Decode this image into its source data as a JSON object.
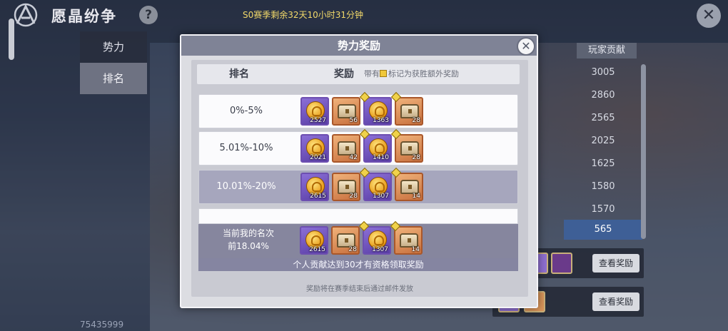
{
  "header": {
    "title": "愿晶纷争",
    "help_label": "?",
    "season_text": "S0赛季剩余32天10小时31分钟",
    "close_label": "✕"
  },
  "side_tabs": [
    {
      "label": "势力"
    },
    {
      "label": "排名"
    }
  ],
  "background_list": {
    "column_header": "玩家贡献",
    "values": [
      "3005",
      "2860",
      "2565",
      "2025",
      "1625",
      "1580",
      "1570",
      "565"
    ],
    "view_reward_label": "查看奖励",
    "player_id": "75435999"
  },
  "modal": {
    "title": "势力奖励",
    "close_label": "✕",
    "col_rank": "排名",
    "col_reward": "奖励",
    "note_prefix": "带有",
    "note_suffix": "标记为获胜额外奖励",
    "tiers": [
      {
        "label": "0%-5%",
        "items": [
          {
            "type": "coin",
            "qty": "2527",
            "bonus": false
          },
          {
            "type": "chest",
            "qty": "56",
            "bonus": false
          },
          {
            "type": "coin",
            "qty": "1363",
            "bonus": true
          },
          {
            "type": "chest",
            "qty": "28",
            "bonus": true
          }
        ]
      },
      {
        "label": "5.01%-10%",
        "items": [
          {
            "type": "coin",
            "qty": "2021",
            "bonus": false
          },
          {
            "type": "chest",
            "qty": "42",
            "bonus": false
          },
          {
            "type": "coin",
            "qty": "1410",
            "bonus": true
          },
          {
            "type": "chest",
            "qty": "28",
            "bonus": true
          }
        ]
      },
      {
        "label": "10.01%-20%",
        "items": [
          {
            "type": "coin",
            "qty": "2615",
            "bonus": false
          },
          {
            "type": "chest",
            "qty": "28",
            "bonus": false
          },
          {
            "type": "coin",
            "qty": "1307",
            "bonus": true
          },
          {
            "type": "chest",
            "qty": "14",
            "bonus": true
          }
        ]
      }
    ],
    "my_rank": {
      "label_line1": "当前我的名次",
      "label_line2": "前18.04%",
      "items": [
        {
          "type": "coin",
          "qty": "2615",
          "bonus": false
        },
        {
          "type": "chest",
          "qty": "28",
          "bonus": false
        },
        {
          "type": "coin",
          "qty": "1307",
          "bonus": true
        },
        {
          "type": "chest",
          "qty": "14",
          "bonus": true
        }
      ]
    },
    "eligibility_notice": "个人贡献达到30才有资格领取奖励",
    "footer_note": "奖励将在赛季结束后通过邮件发放"
  },
  "colors": {
    "accent_gold": "#f2d96a",
    "active_tier": "#a6a6bd",
    "my_rank_row": "#3e5f96"
  }
}
